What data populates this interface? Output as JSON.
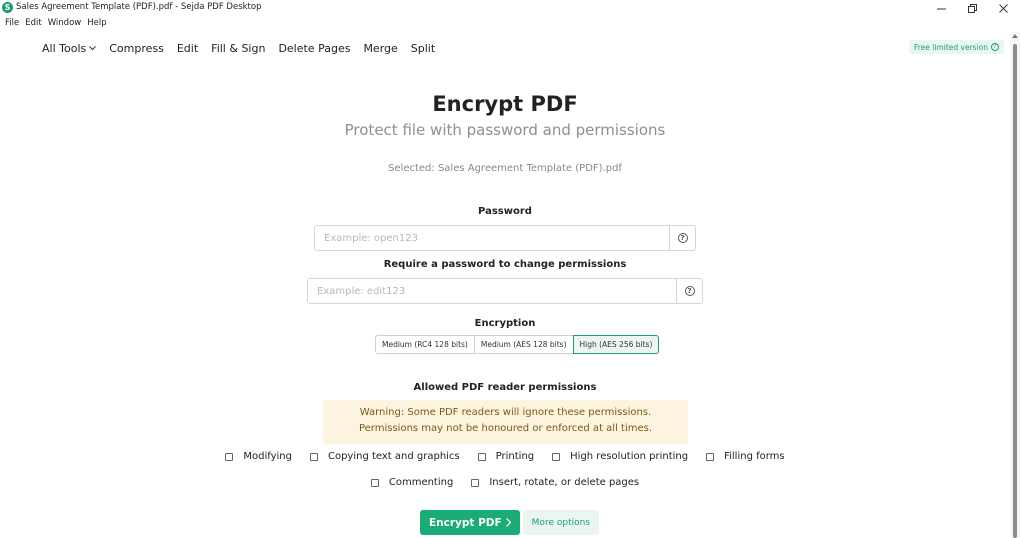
{
  "window": {
    "title": "Sales Agreement Template (PDF).pdf - Sejda PDF Desktop",
    "app_icon": "sejda-logo-icon",
    "app_icon_letter": "S"
  },
  "menubar": [
    "File",
    "Edit",
    "Window",
    "Help"
  ],
  "topnav": {
    "items": [
      "All Tools",
      "Compress",
      "Edit",
      "Fill & Sign",
      "Delete Pages",
      "Merge",
      "Split"
    ],
    "free_badge": "Free limited version"
  },
  "main": {
    "title": "Encrypt PDF",
    "subtitle": "Protect file with password and permissions",
    "selected_file": "Selected: Sales Agreement Template (PDF).pdf",
    "password": {
      "label": "Password",
      "placeholder": "Example: open123",
      "value": ""
    },
    "permissions_password": {
      "label": "Require a password to change permissions",
      "placeholder": "Example: edit123",
      "value": ""
    },
    "encryption": {
      "label": "Encryption",
      "options": [
        "Medium (RC4 128 bits)",
        "Medium (AES 128 bits)",
        "High (AES 256 bits)"
      ],
      "selected": "High (AES 256 bits)"
    },
    "permissions": {
      "label": "Allowed PDF reader permissions",
      "warning_line1": "Warning: Some PDF readers will ignore these permissions.",
      "warning_line2": "Permissions may not be honoured or enforced at all times.",
      "items_row1": [
        "Modifying",
        "Copying text and graphics",
        "Printing",
        "High resolution printing",
        "Filling forms"
      ],
      "items_row2": [
        "Commenting",
        "Insert, rotate, or delete pages"
      ]
    },
    "actions": {
      "encrypt_label": "Encrypt PDF",
      "more_label": "More options"
    }
  },
  "colors": {
    "accent": "#1aab76",
    "accent_light": "#eaf7f1",
    "warning_bg": "#fdf4df"
  }
}
